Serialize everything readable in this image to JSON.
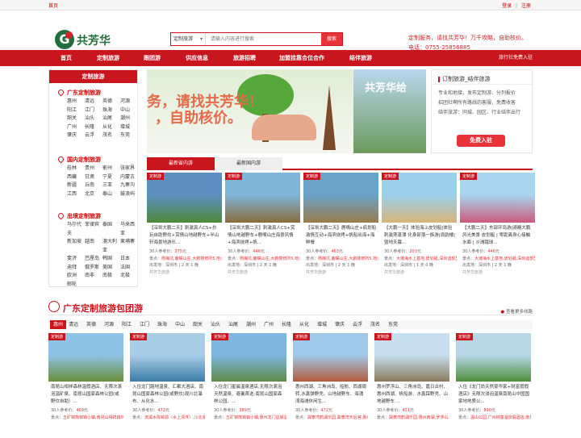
{
  "topbar": {
    "home": "首页",
    "login": "登录",
    "sep": "|",
    "register": "注册"
  },
  "logo": {
    "mark": "G",
    "name": "共芳华"
  },
  "search": {
    "select": "定制旅游",
    "placeholder": "请输入内容进行搜索",
    "button": "搜索"
  },
  "header_right": {
    "line1": "定制服务，请找共芳华！万千攻略，自助核价。",
    "line2": "电话：0755-25856885"
  },
  "nav": {
    "items": [
      "首页",
      "定制旅游",
      "跟团游",
      "供应信息",
      "旅游招聘",
      "加盟挂靠合位合作",
      "结伴旅游"
    ],
    "right": "旅行社免费入驻"
  },
  "sidebar": {
    "title": "定制旅游",
    "sections": [
      {
        "title": "广东定制旅游",
        "items": [
          "惠州",
          "清远",
          "英德",
          "河源",
          "阳江",
          "江门",
          "珠海",
          "中山",
          "韶关",
          "汕头",
          "汕尾",
          "潮州",
          "广州",
          "长隆",
          "从化",
          "增城",
          "肇庆",
          "云浮",
          "茂名",
          "东莞"
        ]
      },
      {
        "title": "国内定制旅游",
        "items": [
          "桂林",
          "贵州",
          "嵛州",
          "张家界",
          "西藏",
          "甘肃",
          "宁夏",
          "内蒙古",
          "新疆",
          "丘南",
          "三亚",
          "九寨沟",
          "江西",
          "北京",
          "泰山",
          "鼓浪屿"
        ]
      },
      {
        "title": "出境定制旅游",
        "items": [
          "马尔代夫",
          "菲律宾",
          "泰国",
          "马来西亚",
          "新加坡",
          "越南",
          "澳大利亚",
          "柬埔寨",
          "斐济",
          "巴厘岛",
          "韩国",
          "日本",
          "迪拜",
          "俄罗斯",
          "美国",
          "法国",
          "欧洲",
          "南非",
          "南极",
          "北极",
          "邮轮"
        ]
      }
    ]
  },
  "banner": {
    "left_text_1": "务，请找共芳华！",
    "left_text_2": "，自助核价。",
    "right_text": "共芳华给"
  },
  "side_box": {
    "title": "订制旅游_结伴旅游",
    "items": [
      "专业和地接，发布定制游、分列报价",
      "招团社啊所有路线的客服，免费收客",
      "结伴旅游：同城、园区、行业结伴出行"
    ],
    "button": "免费入驻"
  },
  "tabs": [
    "最新省内游",
    "最新国内游"
  ],
  "tour_cards": [
    {
      "tag": "定制游",
      "title": "【深圳大鹏二天】刺激真人CS+抄玩自助野炊+赏情山地越野车+半山轩海景地游乐...",
      "price_label": "30人参考价：",
      "price": "375",
      "unit": "元",
      "spot_label": "景点：",
      "spots": "杨梅坑,鹿嘴山庄,大鹏楼修所5,地大南山至...",
      "origin": "出发地：深圳市 | 2 天 1 晚",
      "agency": "共芳华旅游"
    },
    {
      "tag": "定制游",
      "title": "【深圳大鹏二天】刺激真人CS+赏情山地越野车+鹿嘴山庄海景风情+海滨烧烤+帆...",
      "price_label": "30人参考价：",
      "price": "446",
      "unit": "元",
      "spot_label": "景点：",
      "spots": "杨梅坑,鹿嘴山庄,大鹏楼修所5,地大南山至...",
      "origin": "出发地：深圳市 | 2 天 1 晚",
      "agency": "共芳华旅游"
    },
    {
      "tag": "定制游",
      "title": "【深圳大鹏二天】鹿嘴山庄+疯划船激情互动+海滨烧烤+帆船出海+海鲜餐",
      "price_label": "30人参考价：",
      "price": "463",
      "unit": "元",
      "spot_label": "景点：",
      "spots": "杨梅坑,鹿嘴山庄,大鹏楼修所5,地大南山至...",
      "origin": "出发地：深圳市 | 2 天 1 晚",
      "agency": "共芳华旅游"
    },
    {
      "tag": "定制游",
      "title": "【大鹏一天】体验海上皮划艇|体验刺激莲蓬漂 化身部落一族游|浪韵楼|暨地天幕...",
      "price_label": "30人参考价：",
      "price": "203",
      "unit": "元",
      "spot_label": "景点：",
      "spots": "大滩海水上基地,皮划艇,深圳迪部里团建拓展基地,...",
      "origin": "出发地：深圳市 | 1 天 0 晚",
      "agency": "共芳华旅游"
    },
    {
      "tag": "定制游",
      "title": "【大鹏二天】东部环岛游|骑略大鹏风光美景 皮划艇 | 零距离身心接触水面 | 沙滩踏球...",
      "price_label": "30人参考价：",
      "price": "446",
      "unit": "元",
      "spot_label": "景点：",
      "spots": "大滩海水上基地,皮划艇,深圳迪部里团建拓展基,...",
      "origin": "出发地：深圳市 | 2 天 1 晚",
      "agency": "共芳华旅游"
    }
  ],
  "section2": {
    "title": "广东定制旅游包团游",
    "more": "查看更多线路"
  },
  "cities": [
    "惠州",
    "清远",
    "英德",
    "河源",
    "阳江",
    "江门",
    "珠海",
    "中山",
    "韶关",
    "汕头",
    "汕尾",
    "潮州",
    "广州",
    "长隆",
    "从化",
    "增城",
    "肇庆",
    "云浮",
    "茂名",
    "东莞"
  ],
  "group_cards": [
    {
      "tag": "定制游",
      "title": "南昆山相祥森林温假酒店、无限次滚泡温矿泉、南昆山国家森林公园(或野炊自助）...",
      "price_label": "30人参考价：",
      "price": "469",
      "unit": "元",
      "spot_label": "景点：",
      "spots": "五矿锦熊锦锦小镇,南昆山相祥森林温假酒店温泉..."
    },
    {
      "tag": "定制游",
      "title": "入住龙门路地温泉、汇都大酒店、南昆山国家森林公园(或野炊)观川北瀑布、从化水...",
      "price_label": "30人参考价：",
      "price": "472",
      "unit": "元",
      "spot_label": "景点：",
      "spots": "流溪水陈锦源（水上漂浮）,川北瀑布,石河农场..."
    },
    {
      "tag": "定制游",
      "title": "入住龙门星晨温泉酒店,无限次滚泡天然温泉、避暑首选:南昆山国家森林公园、...",
      "price_label": "30人参考价：",
      "price": "389",
      "unit": "元",
      "spot_label": "景点：",
      "spots": "五矿锦熊锦锦小镇,惠州龙门星晨温泉酒店,...惠..."
    },
    {
      "tag": "定制游",
      "title": "惠州西湖、三角洲岛、船舫、西湖周转,水鑫弹野秃、山地越野车、海涌湾海滩休闲生...",
      "price_label": "30人参考价：",
      "price": "472",
      "unit": "元",
      "spot_label": "景点：",
      "spots": "巽寮湾鹤湖乐园,巽寮湾天后宫,惠州西湖..."
    },
    {
      "tag": "定制游",
      "title": "惠州罗浮山、三角洲岛、嘉日古村、惠州西湖、帆船游、水鑫踩野秃、山地越野车 ...",
      "price_label": "30人参考价：",
      "price": "431",
      "unit": "元",
      "spot_label": "景点：",
      "spots": "巽寮湾鹤湖乐园,惠州西湖,罗浮山..."
    },
    {
      "tag": "定制游",
      "title": "入住《龙门尚天然豪华家+财富假假酒店》无限次浸泡温泉南昆山中国国家地地质公...",
      "price_label": "30人参考价：",
      "price": "890",
      "unit": "元",
      "spot_label": "景点：",
      "spots": "温山公园,广州财富温泉假酒店,南昆山国家森..."
    }
  ]
}
